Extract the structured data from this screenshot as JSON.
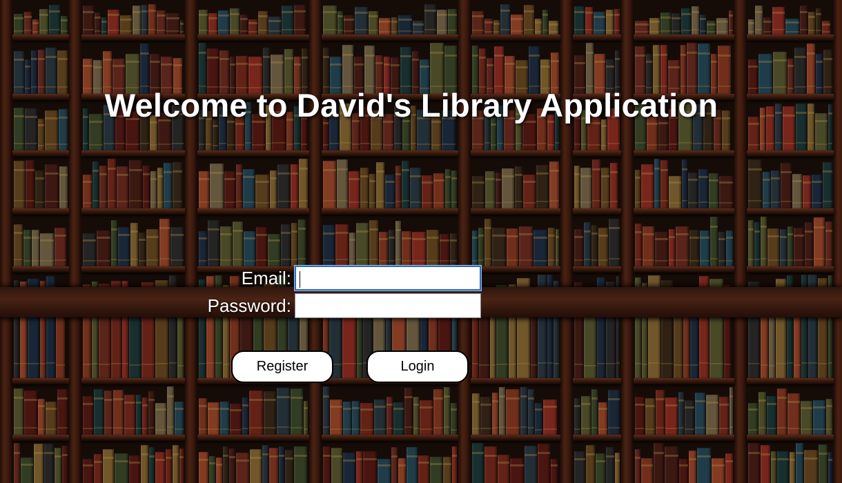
{
  "page": {
    "title": "Welcome to David's Library Application"
  },
  "form": {
    "email_label": "Email:",
    "email_value": "",
    "password_label": "Password:",
    "password_value": "",
    "register_label": "Register",
    "login_label": "Login"
  },
  "colors": {
    "text": "#ffffff",
    "button_bg": "#ffffff",
    "button_border": "#000000",
    "focus_border": "#2d6bbf"
  },
  "background": {
    "description_icon": "bookshelf-background"
  }
}
